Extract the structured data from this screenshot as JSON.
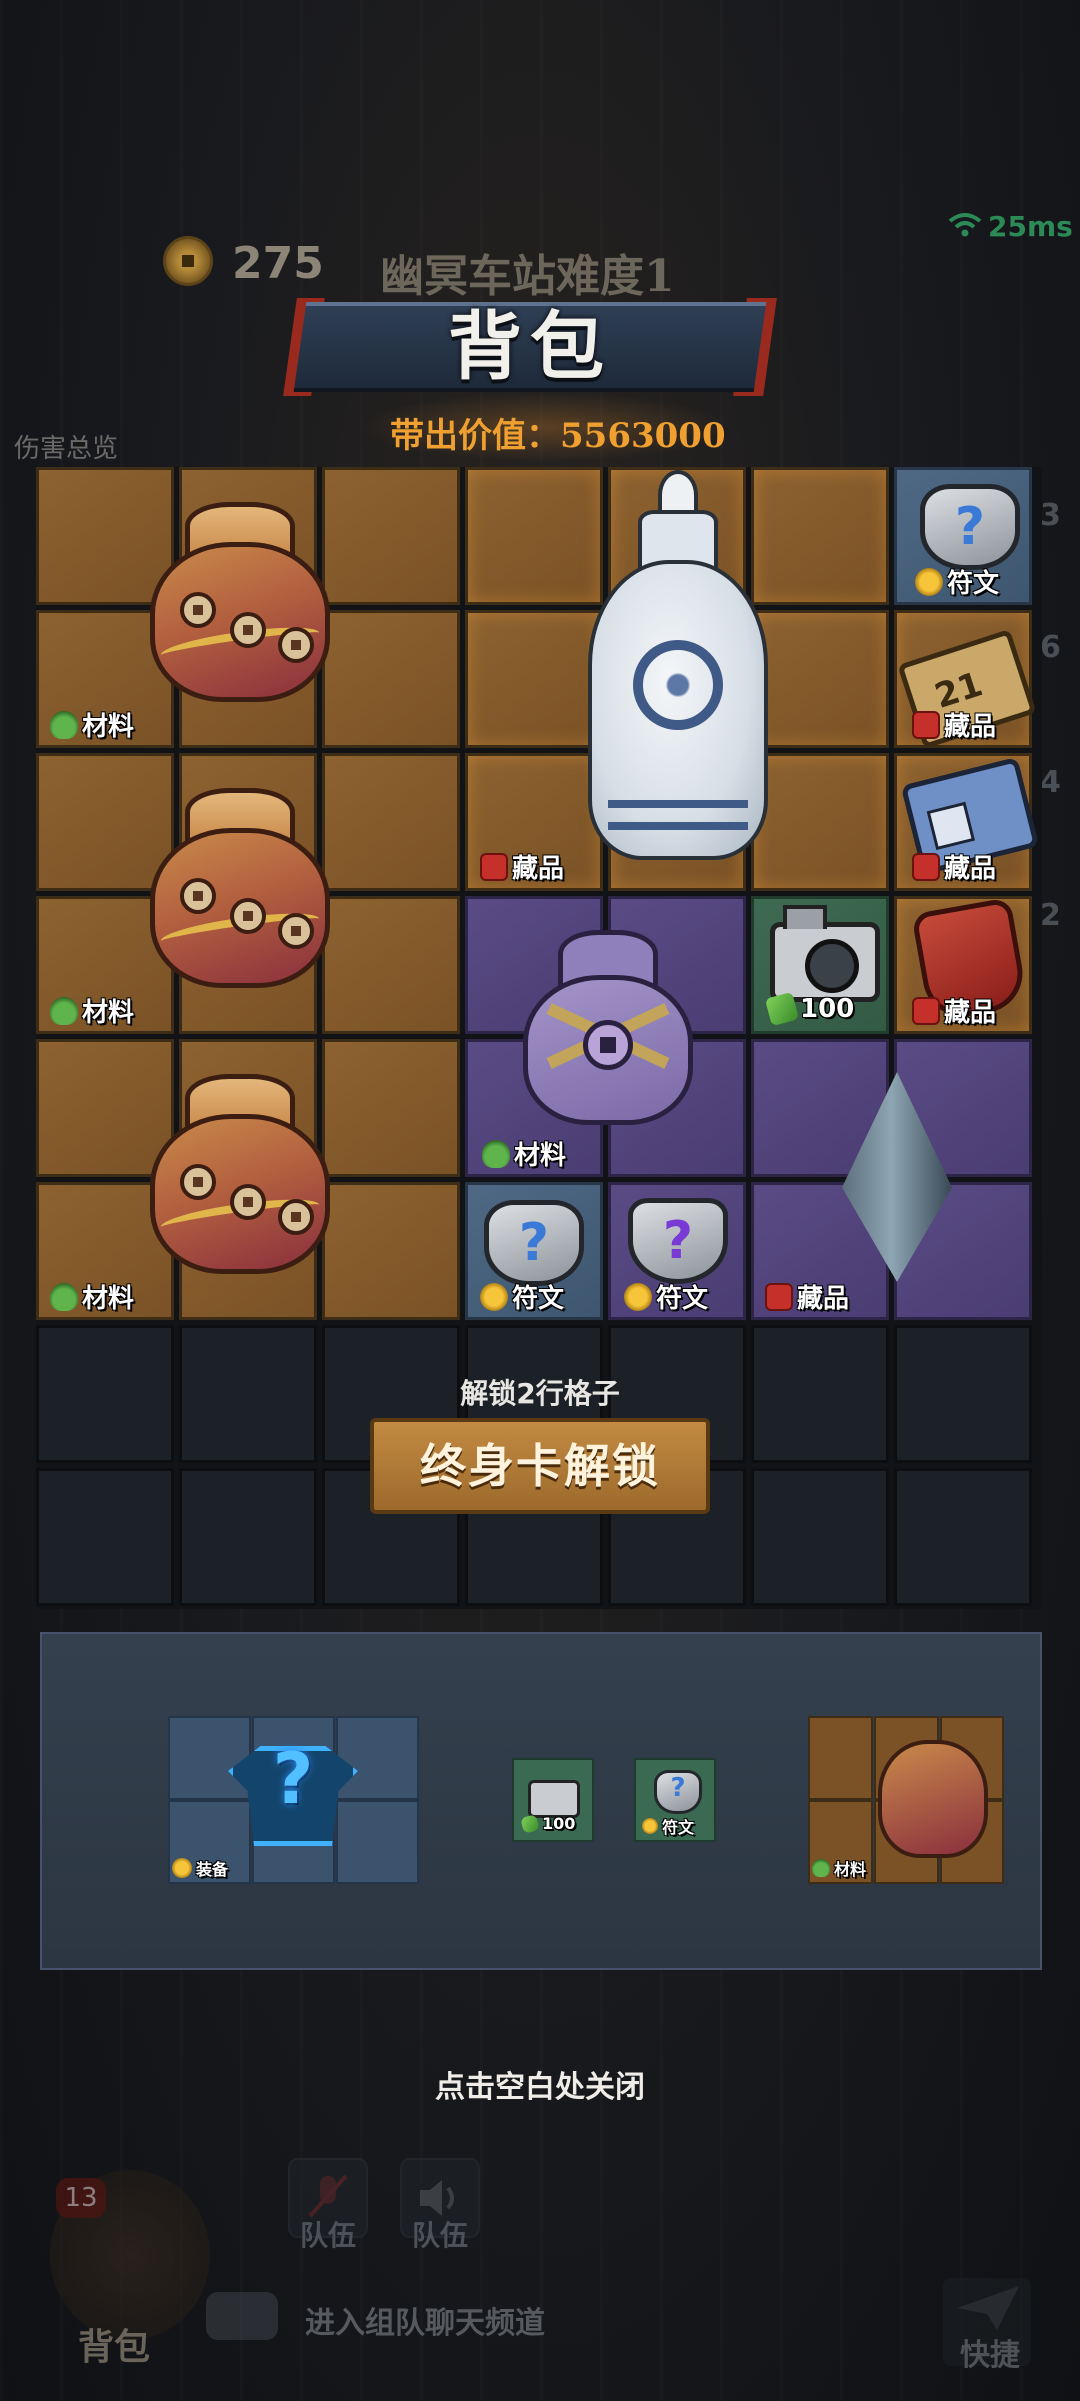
{
  "topbar": {
    "coins": "275",
    "stage_name": "幽冥车站难度1",
    "ping": "25ms",
    "damage_tab": "伤害总览"
  },
  "inventory": {
    "title": "背包",
    "carry_value_label": "带出价值：5563000",
    "unlock_hint": "解锁2行格子",
    "unlock_button": "终身卡解锁"
  },
  "tags": {
    "material": "材料",
    "collectible": "藏品",
    "rune": "符文",
    "equipment": "装备",
    "cash_100": "100"
  },
  "side_numbers": [
    "3",
    "6",
    "4",
    "2"
  ],
  "close_hint": "点击空白处关闭",
  "hud": {
    "bag_count": "13",
    "bag_label": "背包",
    "team_voice_label": "队伍",
    "team_speaker_label": "队伍",
    "chat_placeholder": "进入组队聊天频道",
    "quick_label": "快捷"
  },
  "colors": {
    "value_text": "#f0a030",
    "cell_brown": "#8d6230",
    "cell_purple": "#5a4b85",
    "cell_blue": "#4f6985",
    "cell_green": "#3f6a52",
    "ping_green": "#2c8a56"
  }
}
